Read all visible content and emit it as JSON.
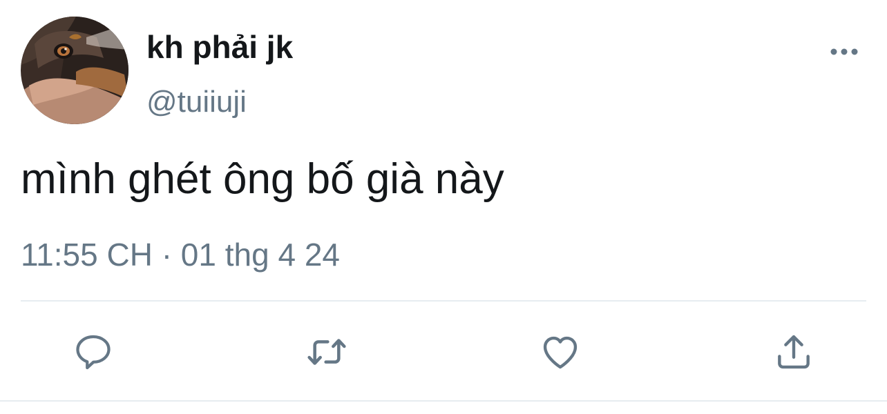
{
  "tweet": {
    "author": {
      "display_name": "kh phải jk",
      "handle": "@tuiiuji",
      "avatar_icon": "dog-avatar"
    },
    "text": "mình ghét ông bố già này",
    "timestamp": "11:55 CH · 01 thg 4 24",
    "menu_icon": "more-icon"
  },
  "actions": {
    "reply_icon": "reply-icon",
    "retweet_icon": "retweet-icon",
    "like_icon": "like-icon",
    "share_icon": "share-icon"
  },
  "colors": {
    "primary_text": "#14171a",
    "secondary_text": "#657786",
    "divider": "#e6ecf0",
    "icon": "#657786"
  }
}
